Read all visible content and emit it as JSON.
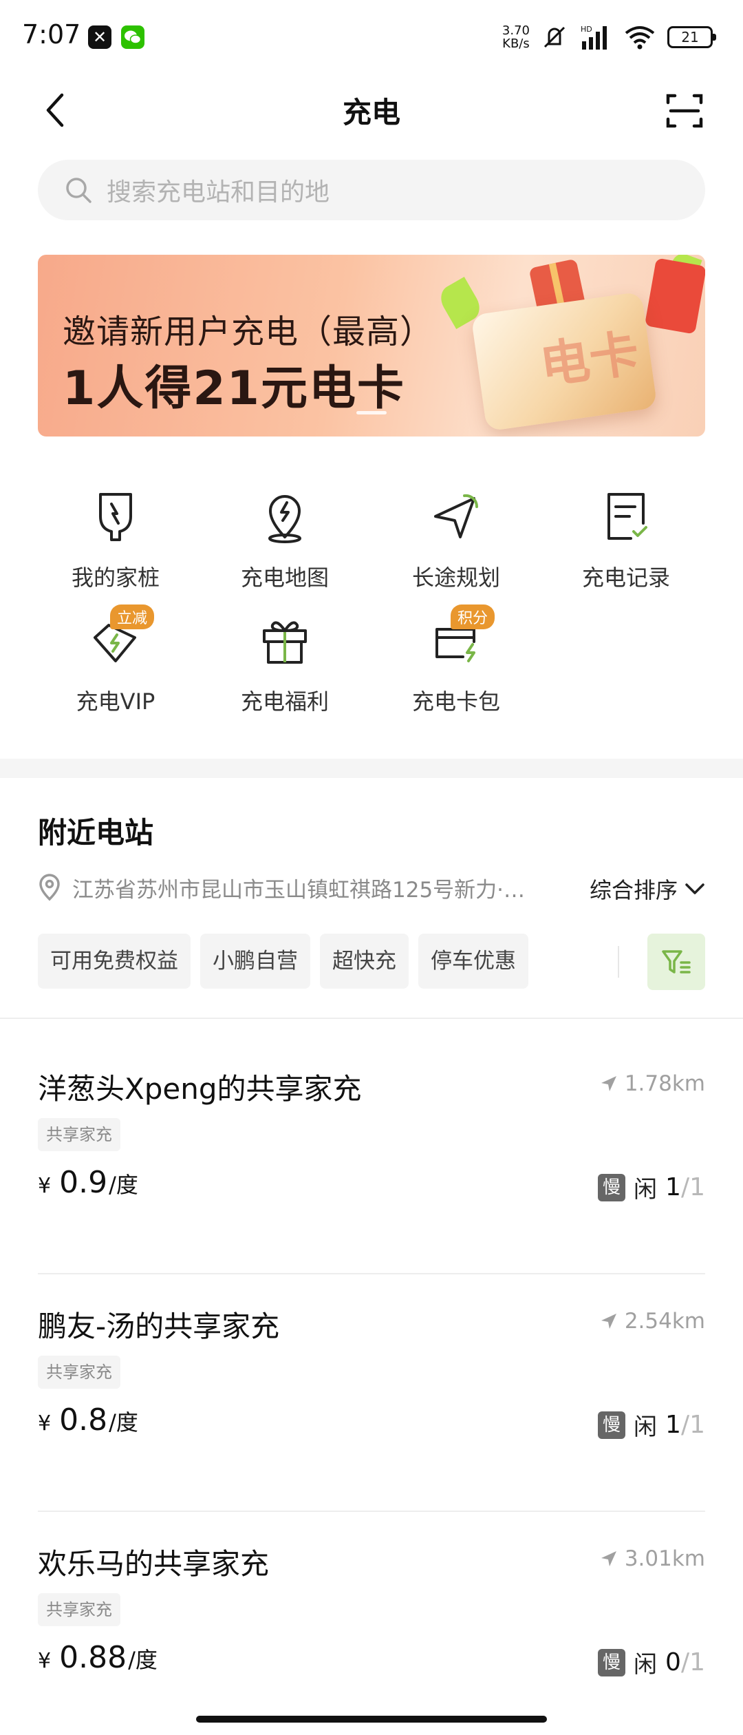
{
  "status_bar": {
    "time": "7:07",
    "net_speed_value": "3.70",
    "net_speed_unit": "KB/s",
    "battery": "21"
  },
  "header": {
    "title": "充电"
  },
  "search": {
    "placeholder": "搜索充电站和目的地"
  },
  "banner": {
    "line1": "邀请新用户充电（最高）",
    "line2": "1人得21元电卡",
    "card_text": "电卡"
  },
  "quick_actions": [
    {
      "label": "我的家桩",
      "icon": "home-charger-icon"
    },
    {
      "label": "充电地图",
      "icon": "charging-map-icon"
    },
    {
      "label": "长途规划",
      "icon": "route-planning-icon"
    },
    {
      "label": "充电记录",
      "icon": "charging-record-icon"
    },
    {
      "label": "充电VIP",
      "icon": "vip-icon",
      "badge": "立减"
    },
    {
      "label": "充电福利",
      "icon": "gift-icon"
    },
    {
      "label": "充电卡包",
      "icon": "card-wallet-icon",
      "badge": "积分"
    }
  ],
  "nearby": {
    "title": "附近电站",
    "address": "江苏省苏州市昆山市玉山镇虹祺路125号新力·…",
    "sort_label": "综合排序",
    "filters": [
      "可用免费权益",
      "小鹏自营",
      "超快充",
      "停车优惠"
    ]
  },
  "stations": [
    {
      "name": "洋葱头Xpeng的共享家充",
      "distance": "1.78km",
      "tag": "共享家充",
      "currency": "¥",
      "price": "0.9",
      "unit": "/度",
      "speed": "慢",
      "status": "闲",
      "available": "1",
      "total": "/1"
    },
    {
      "name": "鹏友-汤的共享家充",
      "distance": "2.54km",
      "tag": "共享家充",
      "currency": "¥",
      "price": "0.8",
      "unit": "/度",
      "speed": "慢",
      "status": "闲",
      "available": "1",
      "total": "/1"
    },
    {
      "name": "欢乐马的共享家充",
      "distance": "3.01km",
      "tag": "共享家充",
      "currency": "¥",
      "price": "0.88",
      "unit": "/度",
      "speed": "慢",
      "status": "闲",
      "available": "0",
      "total": "/1"
    }
  ],
  "colors": {
    "accent_green": "#7ab648",
    "badge_orange": "#e9972e",
    "filter_bg": "#e6f3dc"
  }
}
